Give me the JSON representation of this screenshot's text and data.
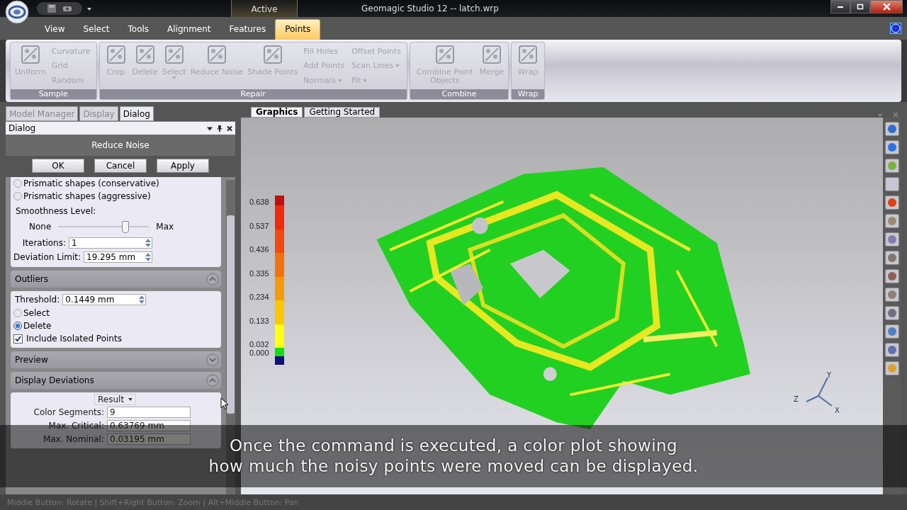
{
  "window": {
    "title": "Geomagic Studio 12 -- latch.wrp",
    "context_tab": "Active"
  },
  "menu_tabs": [
    {
      "label": "View",
      "selected": false
    },
    {
      "label": "Select",
      "selected": false
    },
    {
      "label": "Tools",
      "selected": false
    },
    {
      "label": "Alignment",
      "selected": false
    },
    {
      "label": "Features",
      "selected": false
    },
    {
      "label": "Points",
      "selected": true
    }
  ],
  "ribbon": [
    {
      "name": "Sample",
      "items": [
        {
          "kind": "large",
          "label": "Uniform",
          "disabled": true
        },
        {
          "kind": "small",
          "label": "Curvature",
          "disabled": true
        },
        {
          "kind": "small",
          "label": "Grid",
          "disabled": true
        },
        {
          "kind": "small",
          "label": "Random",
          "disabled": true
        }
      ]
    },
    {
      "name": "Repair",
      "items": [
        {
          "kind": "large",
          "label": "Crop",
          "disabled": true
        },
        {
          "kind": "large",
          "label": "Delete",
          "disabled": true
        },
        {
          "kind": "large",
          "label": "Select",
          "disabled": true,
          "dropdown": true
        },
        {
          "kind": "large",
          "label": "Reduce Noise",
          "disabled": true
        },
        {
          "kind": "large",
          "label": "Shade Points",
          "disabled": true
        },
        {
          "kind": "small",
          "label": "Fill Holes",
          "disabled": true
        },
        {
          "kind": "small",
          "label": "Add Points",
          "disabled": true
        },
        {
          "kind": "small",
          "label": "Normals",
          "disabled": true,
          "dropdown": true
        },
        {
          "kind": "small",
          "label": "Offset Points",
          "disabled": true
        },
        {
          "kind": "small",
          "label": "Scan Lines",
          "disabled": true,
          "dropdown": true
        },
        {
          "kind": "small",
          "label": "Fit",
          "disabled": true,
          "dropdown": true
        }
      ]
    },
    {
      "name": "Combine",
      "items": [
        {
          "kind": "large",
          "label": "Combine Point Objects",
          "disabled": true
        },
        {
          "kind": "large",
          "label": "Merge",
          "disabled": true
        }
      ]
    },
    {
      "name": "Wrap",
      "items": [
        {
          "kind": "large",
          "label": "Wrap",
          "disabled": true
        }
      ]
    }
  ],
  "panel_tabs": [
    {
      "label": "Model Manager",
      "selected": false
    },
    {
      "label": "Display",
      "selected": false
    },
    {
      "label": "Dialog",
      "selected": true
    }
  ],
  "document_tabs": [
    {
      "label": "Graphics",
      "selected": true
    },
    {
      "label": "Getting Started",
      "selected": false
    }
  ],
  "dialog": {
    "header": "Dialog",
    "title": "Reduce Noise",
    "buttons": [
      "OK",
      "Cancel",
      "Apply"
    ],
    "options": [
      {
        "label": "Prismatic shapes (conservative)",
        "selected": false
      },
      {
        "label": "Prismatic shapes (aggressive)",
        "selected": false
      }
    ],
    "smoothness": {
      "label": "Smoothness Level:",
      "min_label": "None",
      "max_label": "Max",
      "level": 0.73
    },
    "fields": [
      {
        "label": "Iterations:",
        "value": "1"
      },
      {
        "label": "Deviation Limit:",
        "value": "19.295 mm"
      }
    ],
    "sections": [
      {
        "title": "Outliers",
        "expanded": true,
        "kind": "outliers",
        "threshold": {
          "label": "Threshold:",
          "value": "0.1449 mm"
        },
        "actions": [
          {
            "label": "Select",
            "selected": false
          },
          {
            "label": "Delete",
            "selected": true
          }
        ],
        "include": {
          "label": "Include Isolated Points",
          "checked": true
        }
      },
      {
        "title": "Preview",
        "expanded": false
      },
      {
        "title": "Display Deviations",
        "expanded": true,
        "kind": "deviations",
        "mode": "Result",
        "fields": [
          {
            "label": "Color Segments:",
            "value": "9"
          },
          {
            "label": "Max. Critical:",
            "value": "0.63769 mm"
          },
          {
            "label": "Max. Nominal:",
            "value": "0.03195 mm"
          }
        ]
      }
    ]
  },
  "legend": {
    "labels": [
      "0.638",
      "0.537",
      "0.436",
      "0.335",
      "0.234",
      "0.133",
      "0.032",
      "0.000"
    ],
    "segments": [
      {
        "color": "#c01010"
      },
      {
        "color": "#f02a0a"
      },
      {
        "color": "#f24a0c"
      },
      {
        "color": "#f4700a"
      },
      {
        "color": "#f69a08"
      },
      {
        "color": "#fac800"
      },
      {
        "color": "#ffff10"
      },
      {
        "color": "#10e010"
      },
      {
        "color": "#10107a"
      }
    ]
  },
  "axes": [
    "Y",
    "Z",
    "X"
  ],
  "caption": [
    "Once the command is executed, a color plot showing",
    "how much the noisy points were moved can be displayed."
  ],
  "status_bar": "Middle Button: Rotate | Shift+Right Button: Zoom | Alt+Middle Button: Pan"
}
